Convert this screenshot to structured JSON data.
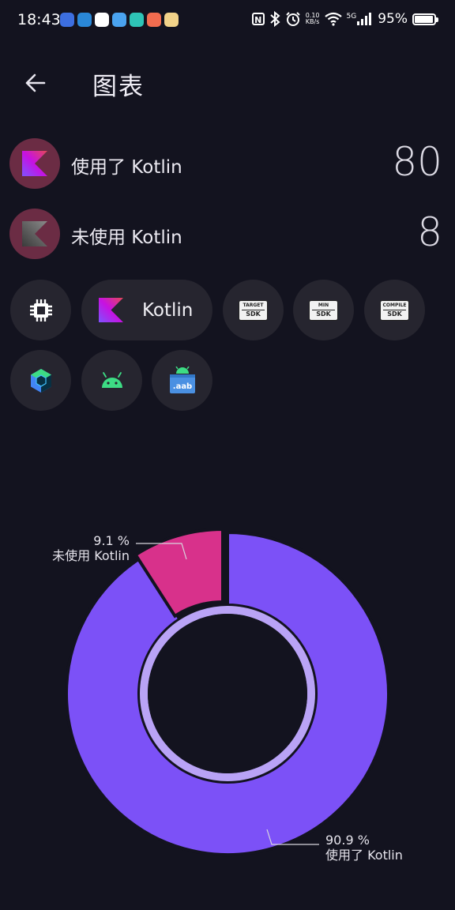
{
  "status_bar": {
    "time": "18:43",
    "network_speed_value": "0.10",
    "network_speed_unit": "KB/s",
    "signal_label": "5G",
    "battery": "95%",
    "battery_level": 0.95
  },
  "header": {
    "title": "图表"
  },
  "stats": [
    {
      "label": "使用了 Kotlin",
      "value": "80"
    },
    {
      "label": "未使用 Kotlin",
      "value": "8"
    }
  ],
  "filters": {
    "kotlin_label": "Kotlin",
    "target_sdk": {
      "top": "TARGET",
      "bottom": "SDK"
    },
    "min_sdk": {
      "top": "MIN",
      "bottom": "SDK"
    },
    "compile_sdk": {
      "top": "COMPILE",
      "bottom": "SDK"
    },
    "aab_label": ".aab"
  },
  "chart_data": {
    "type": "pie",
    "labels": [
      "使用了 Kotlin",
      "未使用 Kotlin"
    ],
    "values": [
      80,
      8
    ],
    "percentages": [
      "90.9 %",
      "9.1 %"
    ],
    "colors": [
      "#7c51f7",
      "#d8318b"
    ]
  }
}
